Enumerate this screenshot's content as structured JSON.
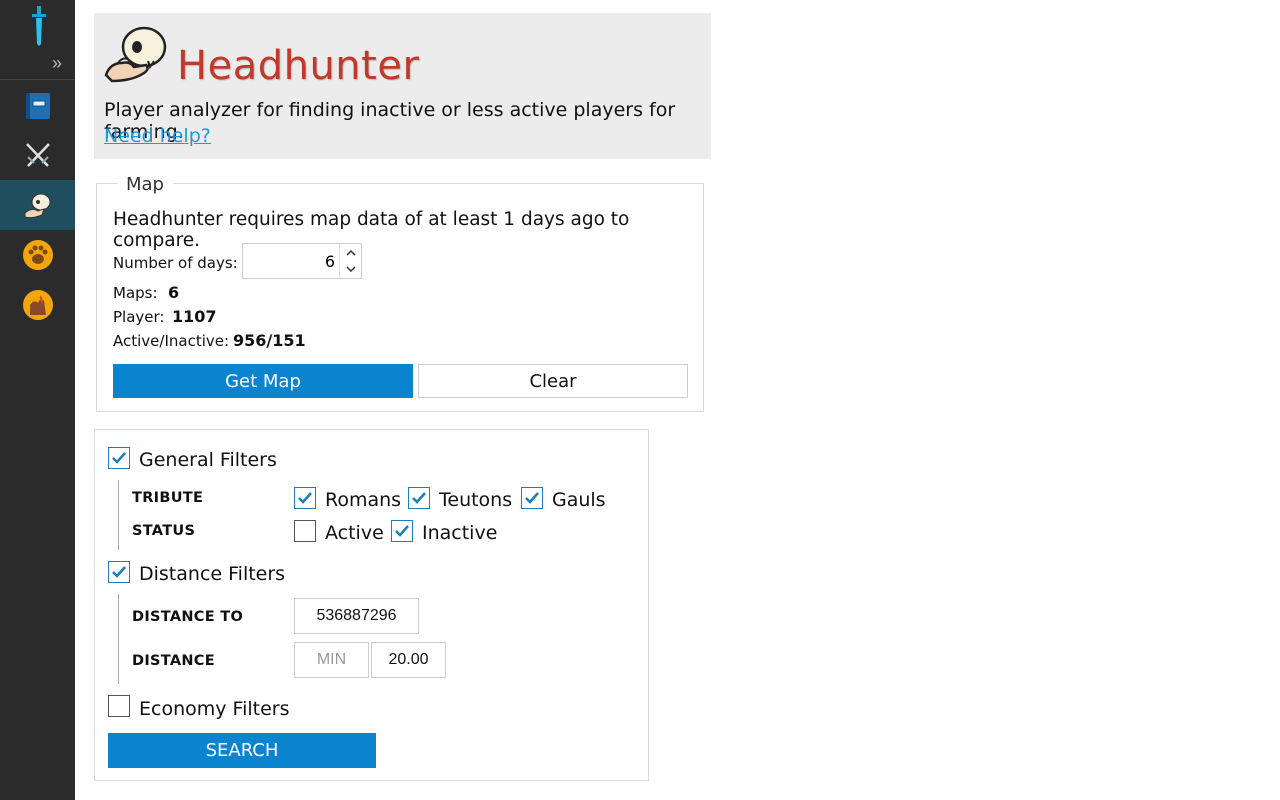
{
  "header": {
    "title": "Headhunter",
    "description": "Player analyzer for finding inactive or less active players for farming.",
    "help_link": "Need help?"
  },
  "map": {
    "legend": "Map",
    "description": "Headhunter requires map data of at least 1 days ago to compare.",
    "days_label": "Number of days:",
    "days_value": "6",
    "maps_label": "Maps:",
    "maps_value": "6",
    "player_label": "Player:",
    "player_value": "1107",
    "active_inactive_label": "Active/Inactive:",
    "active_inactive_value": "956/151",
    "get_map_button": "Get Map",
    "clear_button": "Clear"
  },
  "filters": {
    "general": {
      "label": "General Filters",
      "checked": true,
      "tribute_label": "TRIBUTE",
      "tribes": [
        {
          "label": "Romans",
          "checked": true
        },
        {
          "label": "Teutons",
          "checked": true
        },
        {
          "label": "Gauls",
          "checked": true
        }
      ],
      "status_label": "STATUS",
      "statuses": [
        {
          "label": "Active",
          "checked": false
        },
        {
          "label": "Inactive",
          "checked": true
        }
      ]
    },
    "distance": {
      "label": "Distance Filters",
      "checked": true,
      "distance_to_label": "DISTANCE TO",
      "distance_to_value": "536887296",
      "distance_label": "DISTANCE",
      "min_placeholder": "MIN",
      "max_value": "20.00"
    },
    "economy": {
      "label": "Economy Filters",
      "checked": false
    },
    "search_button": "SEARCH"
  },
  "sidebar": {
    "items": [
      {
        "icon": "book-icon"
      },
      {
        "icon": "crossed-swords-icon"
      },
      {
        "icon": "skull-hand-icon",
        "active": true
      },
      {
        "icon": "paw-icon"
      },
      {
        "icon": "fire-hand-icon"
      }
    ]
  },
  "colors": {
    "accent": "#0b84cf",
    "title": "#c0392b",
    "link": "#1a9be0",
    "sidebar_bg": "#2b2b2b",
    "sidebar_active": "#1f4f5f"
  }
}
